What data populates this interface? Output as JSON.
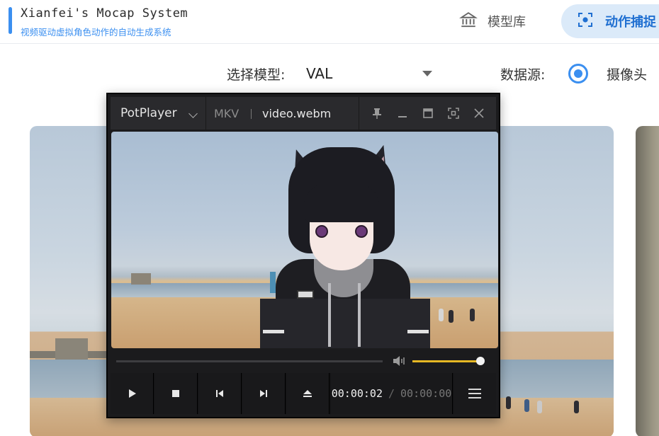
{
  "header": {
    "brand_title": "Xianfei's Mocap System",
    "brand_subtitle": "视频驱动虚拟角色动作的自动生成系统",
    "nav": [
      {
        "label": "模型库",
        "icon": "library-icon",
        "active": false
      },
      {
        "label": "动作捕捉",
        "icon": "focus-capture-icon",
        "active": true
      }
    ]
  },
  "controls": {
    "model_label": "选择模型:",
    "model_value": "VAL",
    "source_label": "数据源:",
    "source_option": "摄像头",
    "source_selected": true
  },
  "player": {
    "app_name": "PotPlayer",
    "format": "MKV",
    "file_name": "video.webm",
    "window_buttons": [
      "pin-icon",
      "minimize-icon",
      "maximize-icon",
      "fullscreen-icon",
      "close-icon"
    ],
    "seek_progress": 0,
    "volume": 1.0,
    "time_current": "00:00:02",
    "time_separator": "/",
    "time_total": "00:00:00",
    "playback_buttons": [
      "play-icon",
      "stop-icon",
      "previous-icon",
      "next-icon",
      "eject-icon"
    ]
  },
  "colors": {
    "accent": "#3b8ff0",
    "nav_active_bg": "#dbeaf9",
    "player_bg": "#1b1b1d",
    "volume_accent": "#e6b824"
  }
}
